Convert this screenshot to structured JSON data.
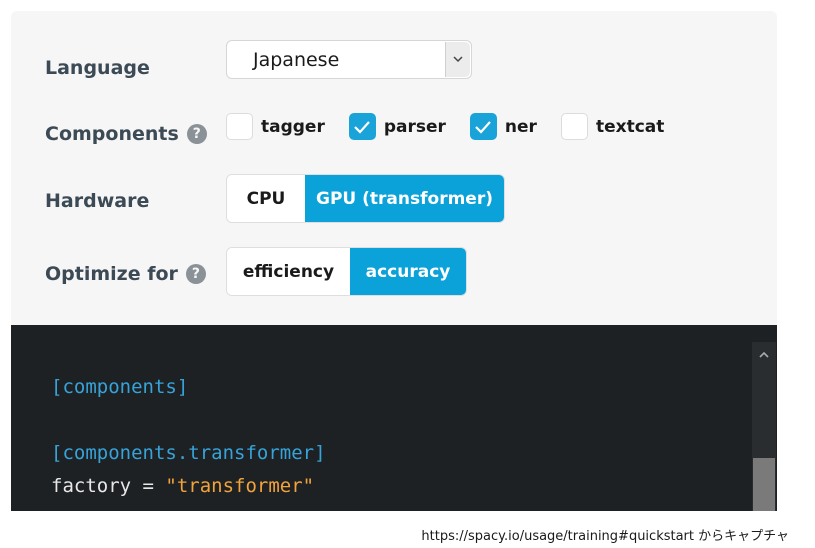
{
  "form": {
    "language": {
      "label": "Language",
      "value": "Japanese"
    },
    "components": {
      "label": "Components",
      "items": [
        {
          "label": "tagger",
          "checked": false
        },
        {
          "label": "parser",
          "checked": true
        },
        {
          "label": "ner",
          "checked": true
        },
        {
          "label": "textcat",
          "checked": false
        }
      ]
    },
    "hardware": {
      "label": "Hardware",
      "options": [
        "CPU",
        "GPU (transformer)"
      ],
      "selected": "GPU (transformer)"
    },
    "optimize": {
      "label": "Optimize for",
      "options": [
        "efficiency",
        "accuracy"
      ],
      "selected": "accuracy"
    }
  },
  "code": {
    "line1": "[components]",
    "line2": "[components.transformer]",
    "line3_key": "factory",
    "line3_eq": " = ",
    "line3_val": "\"transformer\""
  },
  "caption": "https://spacy.io/usage/training#quickstart からキャプチャ",
  "colors": {
    "accent": "#0aa2d8",
    "panel": "#f6f6f6",
    "code_bg": "#1e2124"
  },
  "icons": {
    "help": "question-circle-icon",
    "select": "chevron-down-icon",
    "check": "checkmark-icon"
  }
}
